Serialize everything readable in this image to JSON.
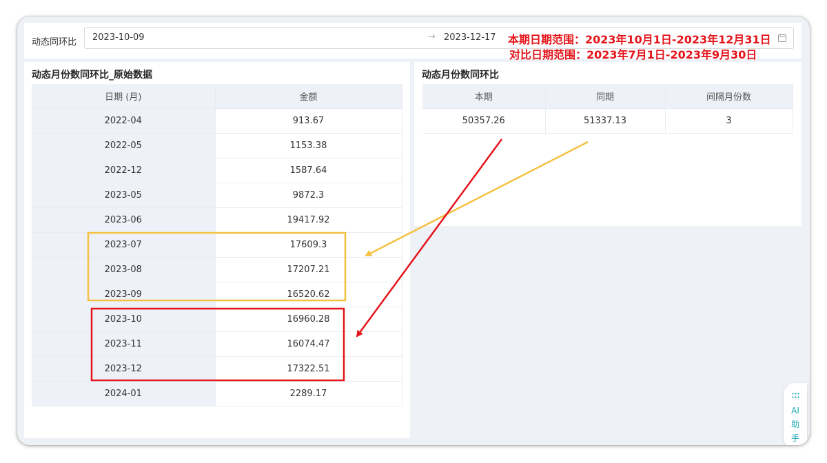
{
  "filter": {
    "label": "动态同环比",
    "start_date": "2023-10-09",
    "arrow": "→",
    "end_date": "2023-12-17"
  },
  "annotations": {
    "current_range": "本期日期范围：2023年10月1日-2023年12月31日",
    "compare_range": "对比日期范围：2023年7月1日-2023年9月30日",
    "colors": {
      "text": "#e4141a",
      "current_box": "#e4141a",
      "compare_box": "#f5c142"
    }
  },
  "left_panel": {
    "title": "动态月份数同环比_原始数据",
    "headers": [
      "日期 (月)",
      "金额"
    ],
    "rows": [
      [
        "2022-04",
        "913.67"
      ],
      [
        "2022-05",
        "1153.38"
      ],
      [
        "2022-12",
        "1587.64"
      ],
      [
        "2023-05",
        "9872.3"
      ],
      [
        "2023-06",
        "19417.92"
      ],
      [
        "2023-07",
        "17609.3"
      ],
      [
        "2023-08",
        "17207.21"
      ],
      [
        "2023-09",
        "16520.62"
      ],
      [
        "2023-10",
        "16960.28"
      ],
      [
        "2023-11",
        "16074.47"
      ],
      [
        "2023-12",
        "17322.51"
      ],
      [
        "2024-01",
        "2289.17"
      ]
    ]
  },
  "right_panel": {
    "title": "动态月份数同环比",
    "headers": [
      "本期",
      "同期",
      "间隔月份数"
    ],
    "row": [
      "50357.26",
      "51337.13",
      "3"
    ]
  },
  "ai_widget": {
    "label": "AI 助手",
    "icon": "dots-grid-icon"
  }
}
